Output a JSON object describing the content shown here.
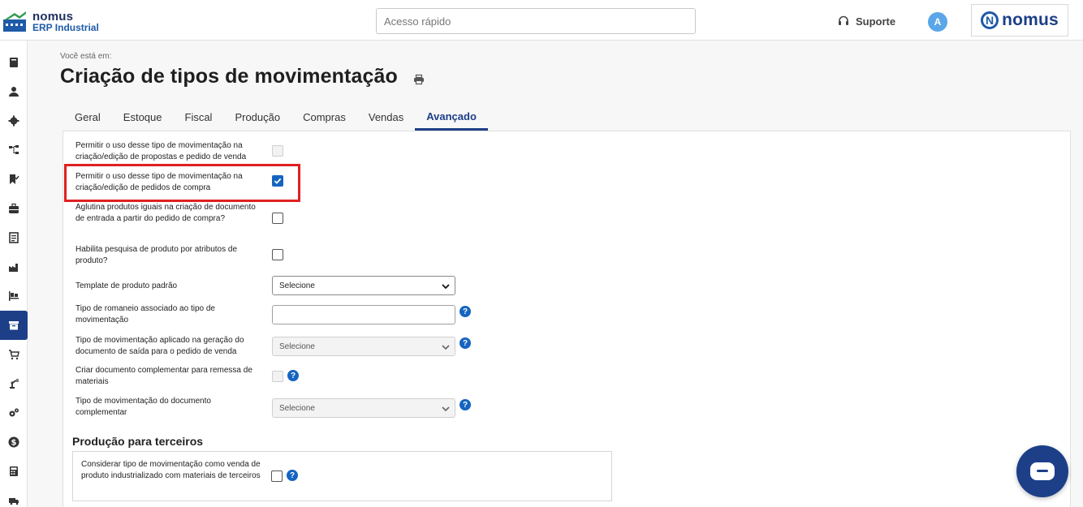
{
  "header": {
    "logo_line1": "nomus",
    "logo_line2": "ERP Industrial",
    "quick_search_placeholder": "Acesso rápido",
    "support_label": "Suporte",
    "avatar_letter": "A",
    "brand_text": "nomus",
    "brand_letter": "N"
  },
  "sidebar": {
    "items": [
      {
        "icon": "book-icon"
      },
      {
        "icon": "user-icon"
      },
      {
        "icon": "gear-icon"
      },
      {
        "icon": "hierarchy-icon"
      },
      {
        "icon": "bookmark-check-icon"
      },
      {
        "icon": "briefcase-icon"
      },
      {
        "icon": "document-list-icon"
      },
      {
        "icon": "factory-icon"
      },
      {
        "icon": "pallet-icon"
      },
      {
        "icon": "archive-icon",
        "active": true
      },
      {
        "icon": "cart-icon"
      },
      {
        "icon": "robot-arm-icon"
      },
      {
        "icon": "gears-icon"
      },
      {
        "icon": "dollar-icon"
      },
      {
        "icon": "calculator-icon"
      },
      {
        "icon": "truck-icon"
      }
    ]
  },
  "breadcrumb": "Você está em:",
  "page_title": "Criação de tipos de movimentação",
  "tabs": [
    "Geral",
    "Estoque",
    "Fiscal",
    "Produção",
    "Compras",
    "Vendas",
    "Avançado"
  ],
  "active_tab": "Avançado",
  "form": {
    "allow_sales": {
      "label": "Permitir o uso desse tipo de movimentação na criação/edição de propostas e pedido de venda",
      "checked": false,
      "disabled": true
    },
    "allow_purchase": {
      "label": "Permitir o uso desse tipo de movimentação na criação/edição de pedidos de compra",
      "checked": true
    },
    "group_products": {
      "label": "Aglutina produtos iguais na criação de documento de entrada a partir do pedido de compra?",
      "checked": false
    },
    "attr_search": {
      "label": "Habilita pesquisa de produto por atributos de produto?",
      "checked": false
    },
    "product_template": {
      "label": "Template de produto padrão",
      "value": "Selecione"
    },
    "romaneio_type": {
      "label": "Tipo de romaneio associado ao tipo de movimentação",
      "value": ""
    },
    "exit_doc_type": {
      "label": "Tipo de movimentação aplicado na geração do documento de saída para o pedido de venda",
      "value": "Selecione"
    },
    "complementary_doc": {
      "label": "Criar documento complementar para remessa de materiais",
      "checked": false,
      "disabled": true
    },
    "complementary_type": {
      "label": "Tipo de movimentação do documento complementar",
      "value": "Selecione"
    }
  },
  "third_party": {
    "title": "Produção para terceiros",
    "consider_sale": {
      "label": "Considerar tipo de movimentação como venda de produto industrializado com materiais de terceiros",
      "checked": false
    }
  },
  "help_glyph": "?",
  "colors": {
    "primary": "#1d3f88",
    "accent": "#1565c0",
    "highlight": "#e02020"
  }
}
